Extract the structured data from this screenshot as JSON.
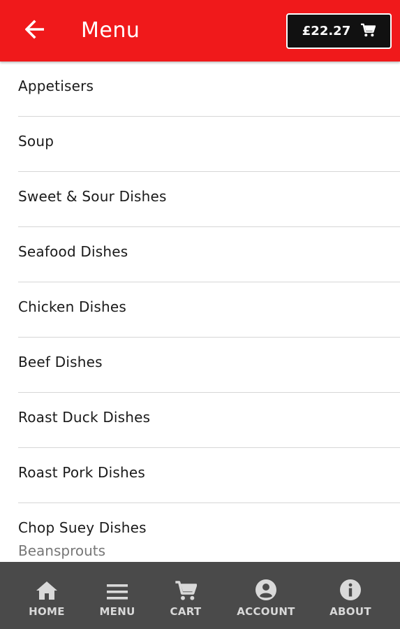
{
  "header": {
    "title": "Menu",
    "cart_total": "£22.27",
    "back_icon": "arrow-left-icon",
    "cart_icon": "shopping-cart-icon",
    "bar_color": "#f0191b"
  },
  "categories": [
    {
      "label": "Appetisers"
    },
    {
      "label": "Soup"
    },
    {
      "label": "Sweet & Sour Dishes"
    },
    {
      "label": "Seafood Dishes"
    },
    {
      "label": "Chicken Dishes"
    },
    {
      "label": "Beef Dishes"
    },
    {
      "label": "Roast Duck Dishes"
    },
    {
      "label": "Roast Pork Dishes"
    },
    {
      "label": "Chop Suey Dishes",
      "subtitle": "Beansprouts"
    }
  ],
  "bottom_nav": {
    "background": "#4a4a4a",
    "items": [
      {
        "label": "HOME",
        "icon": "home-icon"
      },
      {
        "label": "MENU",
        "icon": "menu-icon"
      },
      {
        "label": "CART",
        "icon": "cart-icon"
      },
      {
        "label": "ACCOUNT",
        "icon": "account-icon"
      },
      {
        "label": "ABOUT",
        "icon": "info-icon"
      }
    ]
  }
}
